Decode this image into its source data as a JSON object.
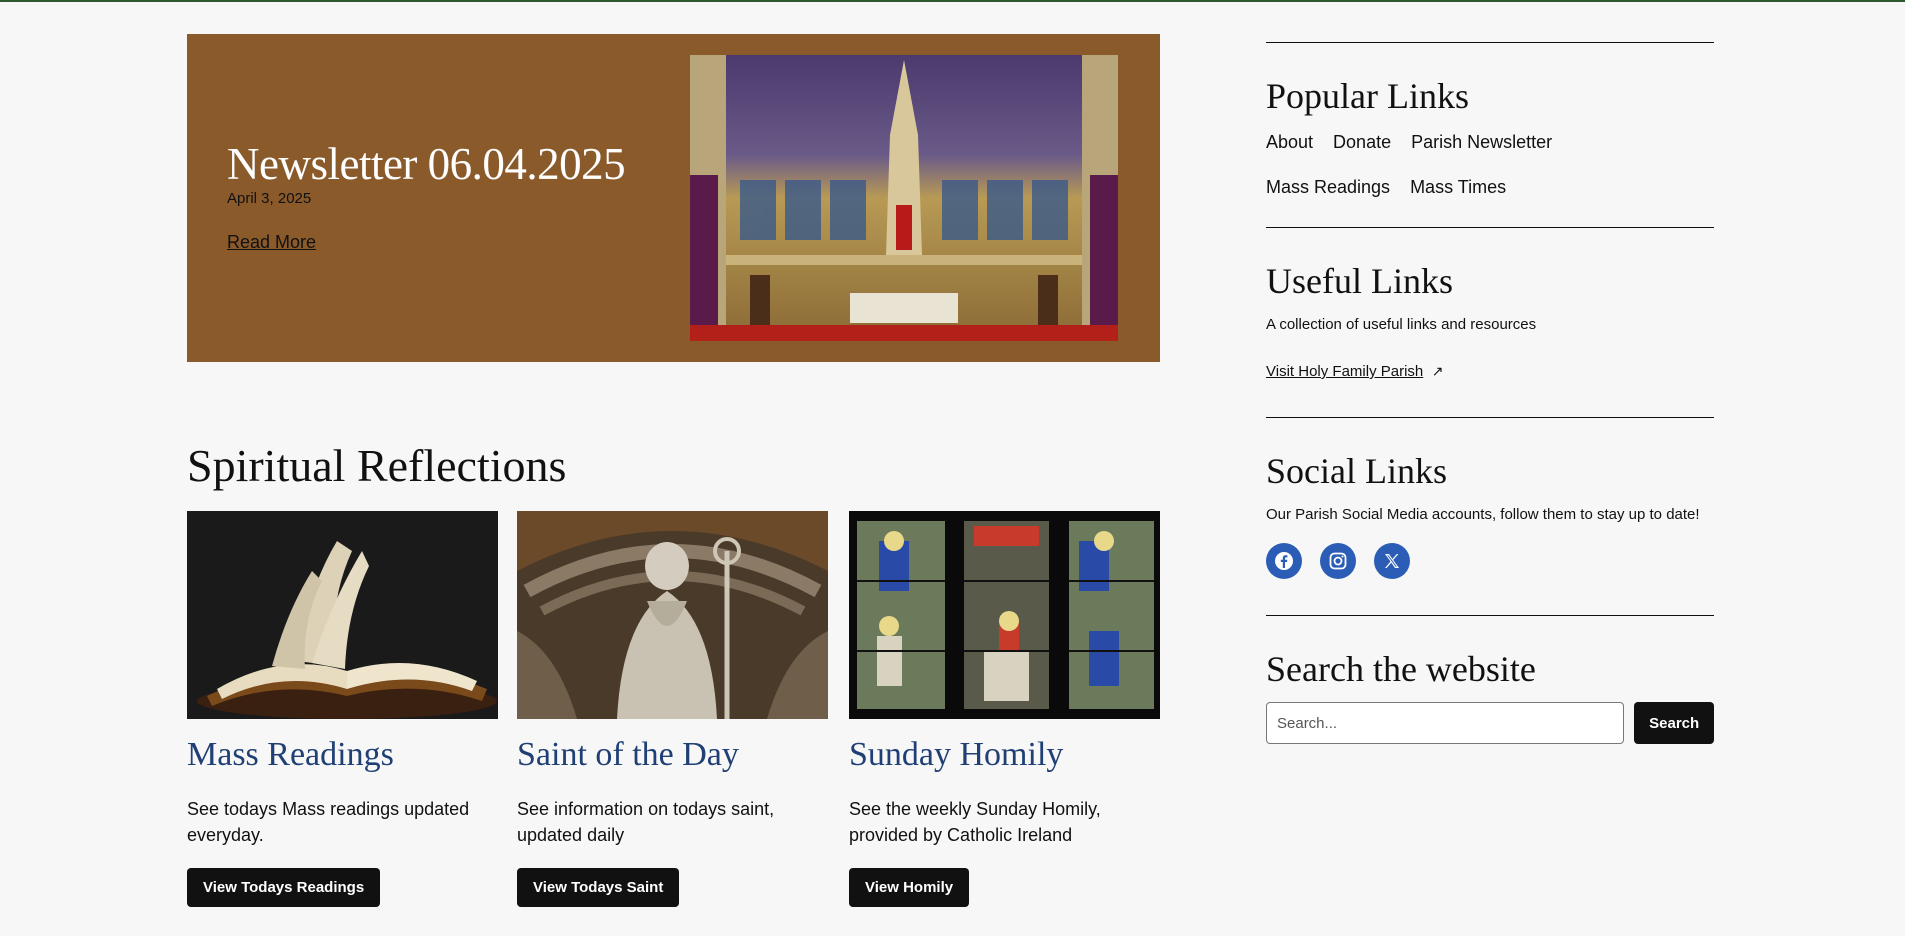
{
  "hero": {
    "title": "Newsletter 06.04.2025",
    "date": "April 3, 2025",
    "read_more": "Read More",
    "image_icon": "church-altar-image"
  },
  "reflections": {
    "title": "Spiritual Reflections",
    "cards": [
      {
        "title": "Mass Readings",
        "desc": "See todays Mass readings updated everyday.",
        "button": "View Todays Readings",
        "image_icon": "open-bible-image"
      },
      {
        "title": "Saint of the Day",
        "desc": "See information on todays saint, updated daily",
        "button": "View Todays Saint",
        "image_icon": "saint-statue-image"
      },
      {
        "title": "Sunday Homily",
        "desc": "See the weekly Sunday Homily, provided by Catholic Ireland",
        "button": "View Homily",
        "image_icon": "stained-glass-image"
      }
    ]
  },
  "sidebar": {
    "popular": {
      "title": "Popular Links",
      "links": [
        "About",
        "Donate",
        "Parish Newsletter",
        "Mass Readings",
        "Mass Times"
      ]
    },
    "useful": {
      "title": "Useful Links",
      "text": "A collection of useful links and resources",
      "link": "Visit Holy Family Parish",
      "link_icon": "external-arrow-icon"
    },
    "social": {
      "title": "Social Links",
      "text": "Our Parish Social Media accounts, follow them to stay up to date!",
      "icons": [
        "facebook-icon",
        "instagram-icon",
        "x-icon"
      ],
      "color": "#2b5db6"
    },
    "search": {
      "title": "Search the website",
      "placeholder": "Search...",
      "button": "Search"
    }
  },
  "colors": {
    "hero_bg": "#8b5a2b",
    "card_title": "#1f3f75",
    "button_bg": "#111111",
    "page_bg": "#f7f7f7"
  }
}
